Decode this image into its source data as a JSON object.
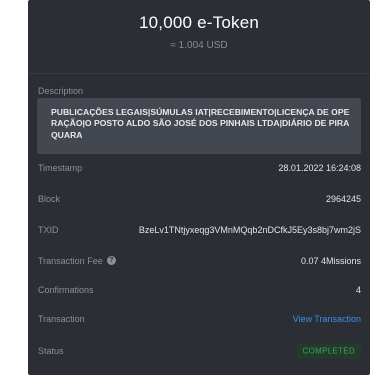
{
  "header": {
    "amount": "10,000 e-Token",
    "fiat": "≈ 1.004 USD"
  },
  "description": {
    "label": "Description",
    "text": "PUBLICAÇÕES LEGAIS|SÚMULAS IAT|RECEBIMENTO|LICENÇA DE OPERAÇÃO|O POSTO ALDO SÃO JOSÉ DOS PINHAIS LTDA|DIÁRIO DE PIRAQUARA"
  },
  "details": {
    "timestamp_label": "Timestamp",
    "timestamp_value": "28.01.2022 16:24:08",
    "block_label": "Block",
    "block_value": "2964245",
    "txid_label": "TXID",
    "txid_value": "BzeLv1TNtjyxeqg3VMnMQqb2nDCfkJ5Ey3s8bj7wm2jS",
    "fee_label": "Transaction Fee",
    "fee_help_icon": "question-circle-icon",
    "fee_value": "0.07 4Missions",
    "confirmations_label": "Confirmations",
    "confirmations_value": "4",
    "transaction_label": "Transaction",
    "transaction_link": "View Transaction",
    "status_label": "Status",
    "status_value": "COMPLETED"
  },
  "colors": {
    "panel_bg": "#2b2e35",
    "link": "#3d8fe6",
    "status_ok": "#37a659"
  }
}
